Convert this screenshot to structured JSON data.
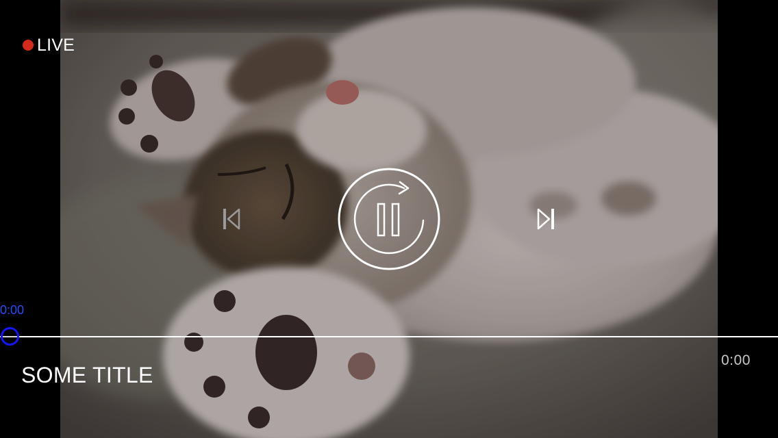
{
  "live": {
    "label": "LIVE",
    "dot_color": "#d42a1c"
  },
  "controls": {
    "previous_icon": "skip-previous-icon",
    "play_pause_icon": "pause-replay-icon",
    "next_icon": "skip-next-icon"
  },
  "progress": {
    "current_time": "0:00",
    "duration": "0:00",
    "played_fraction": 0,
    "track_color": "#ffffff",
    "played_color": "#1c1cff",
    "current_time_color": "#2a4bff",
    "duration_color": "#c8c8c8"
  },
  "video": {
    "title": "SOME TITLE"
  }
}
